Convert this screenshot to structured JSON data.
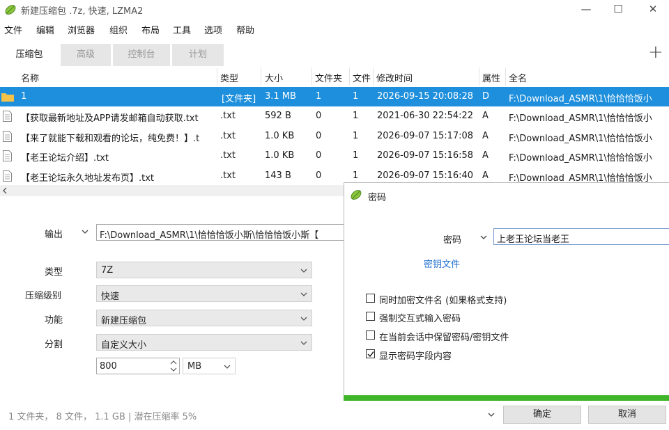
{
  "window": {
    "title": "新建压缩包 .7z, 快速, LZMA2",
    "min": "—",
    "max": "☐",
    "close": "✕"
  },
  "menu": [
    "文件",
    "编辑",
    "浏览器",
    "组织",
    "布局",
    "工具",
    "选项",
    "帮助"
  ],
  "tabs": [
    "压缩包",
    "高级",
    "控制台",
    "计划"
  ],
  "add_button": "+",
  "table": {
    "columns": [
      "名称",
      "类型",
      "大小",
      "文件夹",
      "文件",
      "修改时间",
      "属性",
      "全名"
    ],
    "rows": [
      {
        "name": "1",
        "type": "[文件夹]",
        "size": "3.1 MB",
        "folders": "1",
        "files": "1",
        "mtime": "2026-09-15 20:08:28",
        "attr": "D",
        "full": "F:\\Download_ASMR\\1\\恰恰恰饭小",
        "icon": "folder-icon",
        "selected": true
      },
      {
        "name": "【获取最新地址及APP请发邮箱自动获取.txt",
        "type": ".txt",
        "size": "592 B",
        "folders": "0",
        "files": "1",
        "mtime": "2021-06-30 22:54:22",
        "attr": "A",
        "full": "F:\\Download_ASMR\\1\\恰恰恰饭小",
        "icon": "document-icon"
      },
      {
        "name": "【来了就能下载和观看的论坛，纯免费！】.t",
        "type": ".txt",
        "size": "1.0 KB",
        "folders": "0",
        "files": "1",
        "mtime": "2026-09-07 15:17:08",
        "attr": "A",
        "full": "F:\\Download_ASMR\\1\\恰恰恰饭小",
        "icon": "document-icon"
      },
      {
        "name": "【老王论坛介绍】.txt",
        "type": ".txt",
        "size": "1.0 KB",
        "folders": "0",
        "files": "1",
        "mtime": "2026-09-07 15:16:58",
        "attr": "A",
        "full": "F:\\Download_ASMR\\1\\恰恰恰饭小",
        "icon": "document-icon"
      },
      {
        "name": "【老王论坛永久地址发布页】.txt",
        "type": ".txt",
        "size": "143 B",
        "folders": "0",
        "files": "1",
        "mtime": "2026-09-07 15:16:40",
        "attr": "A",
        "full": "F:\\Download_ASMR\\1\\恰恰恰饭小",
        "icon": "document-icon"
      }
    ]
  },
  "form": {
    "output_label": "输出",
    "output_value": "F:\\Download_ASMR\\1\\恰恰恰饭小斯\\恰恰恰饭小斯【",
    "type_label": "类型",
    "type_value": "7Z",
    "level_label": "压缩级别",
    "level_value": "快速",
    "function_label": "功能",
    "function_value": "新建压缩包",
    "split_label": "分割",
    "split_value": "自定义大小",
    "split_size": "800",
    "split_unit": "MB"
  },
  "dialog": {
    "title": "密码",
    "password_label": "密码",
    "password_value": "上老王论坛当老王",
    "keyfile_link": "密钥文件",
    "options": [
      {
        "label": "同时加密文件名 (如果格式支持)",
        "checked": false
      },
      {
        "label": "强制交互式输入密码",
        "checked": false
      },
      {
        "label": "在当前会话中保留密码/密钥文件",
        "checked": false
      },
      {
        "label": "显示密码字段内容",
        "checked": true
      }
    ]
  },
  "status": "1 文件夹，  8 文件，  1.1 GB | 潜在压缩率 5%",
  "buttons": {
    "ok": "确定",
    "cancel": "取消"
  },
  "colors": {
    "selection": "#1e8fdc",
    "accent_green": "#3fb62a",
    "link": "#1e6fd0"
  }
}
